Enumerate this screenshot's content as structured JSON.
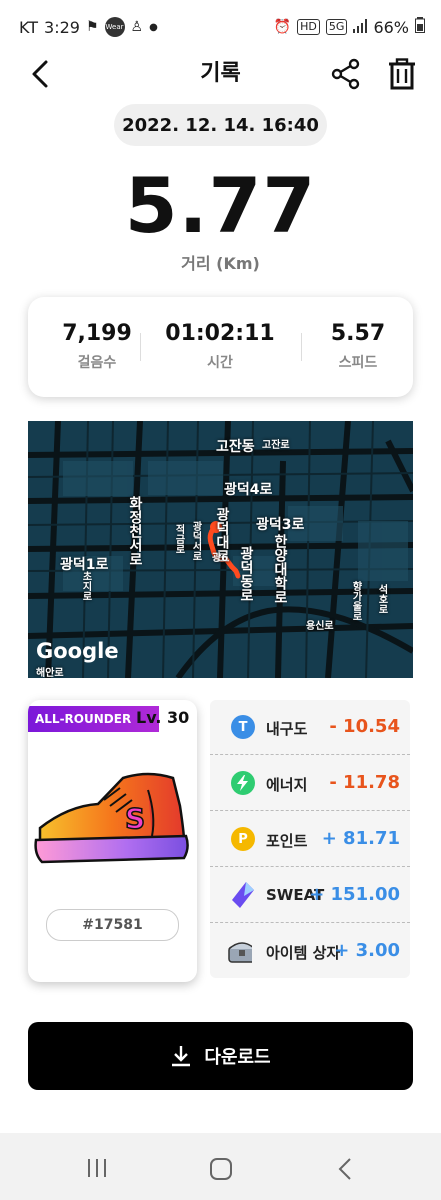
{
  "status": {
    "carrier": "KT",
    "time": "3:29",
    "app_icon": "Wear",
    "hd": "HD",
    "network": "5G",
    "battery": "66%"
  },
  "header": {
    "title": "기록"
  },
  "date": "2022. 12. 14. 16:40",
  "distance": {
    "value": "5.77",
    "label": "거리 (Km)"
  },
  "stats": [
    {
      "value": "7,199",
      "label": "걸음수"
    },
    {
      "value": "01:02:11",
      "label": "시간"
    },
    {
      "value": "5.57",
      "label": "스피드"
    }
  ],
  "map": {
    "labels": {
      "gojandong": "고잔동",
      "gojanro": "고잔로",
      "gwangdeok4ro": "광덕4로",
      "gwangdeok3ro": "광덕3로",
      "gwangdeok1ro": "광덕1로",
      "hwajeongcheonseoro": "화정천서로",
      "jeokgeumro": "적금로",
      "gwangdeokseoro": "광덕서로",
      "gwangdeokdaero": "광덕대로",
      "gwangdeokdongro": "광덕동로",
      "hanyangdaehakro": "한양대학로",
      "chojiro": "초지로",
      "yongsinro": "용신로",
      "hyanggayulro": "향가울로",
      "seokhoro": "석호로",
      "haeanro": "해안로",
      "pin_label": "광6"
    },
    "attribution": "Google",
    "route_color": "#ff4b1f"
  },
  "nft": {
    "badge": "ALL-ROUNDER",
    "level_prefix": "Lv.",
    "level": "30",
    "id": "#17581"
  },
  "rewards": [
    {
      "icon": "t-icon",
      "symbol": "T",
      "label": "내구도",
      "value": "- 10.54",
      "color": "#e8541c",
      "icon_color": "#3a8ee6"
    },
    {
      "icon": "lightning-icon",
      "symbol": "⚡",
      "label": "에너지",
      "value": "- 11.78",
      "color": "#e8541c",
      "icon_color": "#2ecc71"
    },
    {
      "icon": "p-icon",
      "symbol": "P",
      "label": "포인트",
      "value": "+ 81.71",
      "color": "#3a8ee6",
      "icon_color": "#f5b800"
    },
    {
      "icon": "crystal-icon",
      "symbol": "",
      "label": "SWEAT",
      "value": "+ 151.00",
      "color": "#3a8ee6",
      "icon_color": "#6a4cf0"
    },
    {
      "icon": "chest-icon",
      "symbol": "",
      "label": "아이템 상자",
      "value": "+ 3.00",
      "color": "#3a8ee6",
      "icon_color": "#9aa6b5"
    }
  ],
  "download_label": "다운로드"
}
